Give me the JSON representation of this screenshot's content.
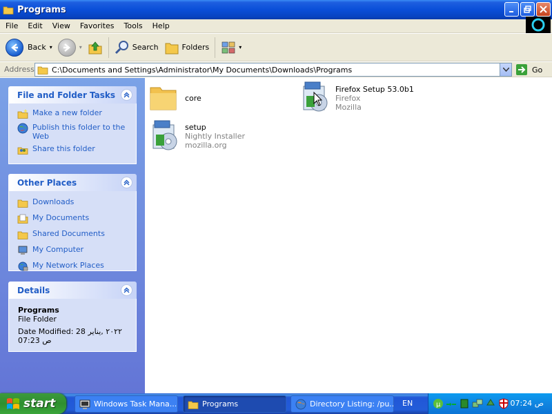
{
  "window": {
    "title": "Programs",
    "icon": "folder-icon"
  },
  "menu": [
    "File",
    "Edit",
    "View",
    "Favorites",
    "Tools",
    "Help"
  ],
  "toolbar": {
    "back_label": "Back",
    "search_label": "Search",
    "folders_label": "Folders"
  },
  "address": {
    "label": "Address",
    "path": "C:\\Documents and Settings\\Administrator\\My Documents\\Downloads\\Programs",
    "go_label": "Go"
  },
  "panels": {
    "tasks": {
      "title": "File and Folder Tasks",
      "items": [
        {
          "label": "Make a new folder",
          "icon": "new-folder-icon"
        },
        {
          "label": "Publish this folder to the Web",
          "icon": "web-publish-icon"
        },
        {
          "label": "Share this folder",
          "icon": "share-icon"
        }
      ]
    },
    "places": {
      "title": "Other Places",
      "items": [
        {
          "label": "Downloads",
          "icon": "folder-icon"
        },
        {
          "label": "My Documents",
          "icon": "documents-icon"
        },
        {
          "label": "Shared Documents",
          "icon": "folder-icon"
        },
        {
          "label": "My Computer",
          "icon": "computer-icon"
        },
        {
          "label": "My Network Places",
          "icon": "network-icon"
        }
      ]
    },
    "details": {
      "title": "Details",
      "name": "Programs",
      "type": "File Folder",
      "modified_line1": "Date Modified: 28 ٢٠٢٢ ,يناير",
      "modified_line2": "07:23 ص"
    }
  },
  "files": [
    {
      "name": "core",
      "sub1": "",
      "sub2": "",
      "icon": "folder-icon"
    },
    {
      "name": "Firefox Setup 53.0b1",
      "sub1": "Firefox",
      "sub2": "Mozilla",
      "icon": "installer-icon"
    },
    {
      "name": "setup",
      "sub1": "Nightly Installer",
      "sub2": "mozilla.org",
      "icon": "installer-icon"
    }
  ],
  "taskbar": {
    "start_label": "start",
    "buttons": [
      {
        "label": "Windows Task Mana...",
        "icon": "task-manager-icon"
      },
      {
        "label": "Programs",
        "icon": "folder-icon"
      },
      {
        "label": "Directory Listing: /pu...",
        "icon": "browser-icon"
      }
    ],
    "language": "EN",
    "clock": "07:24 ص"
  }
}
